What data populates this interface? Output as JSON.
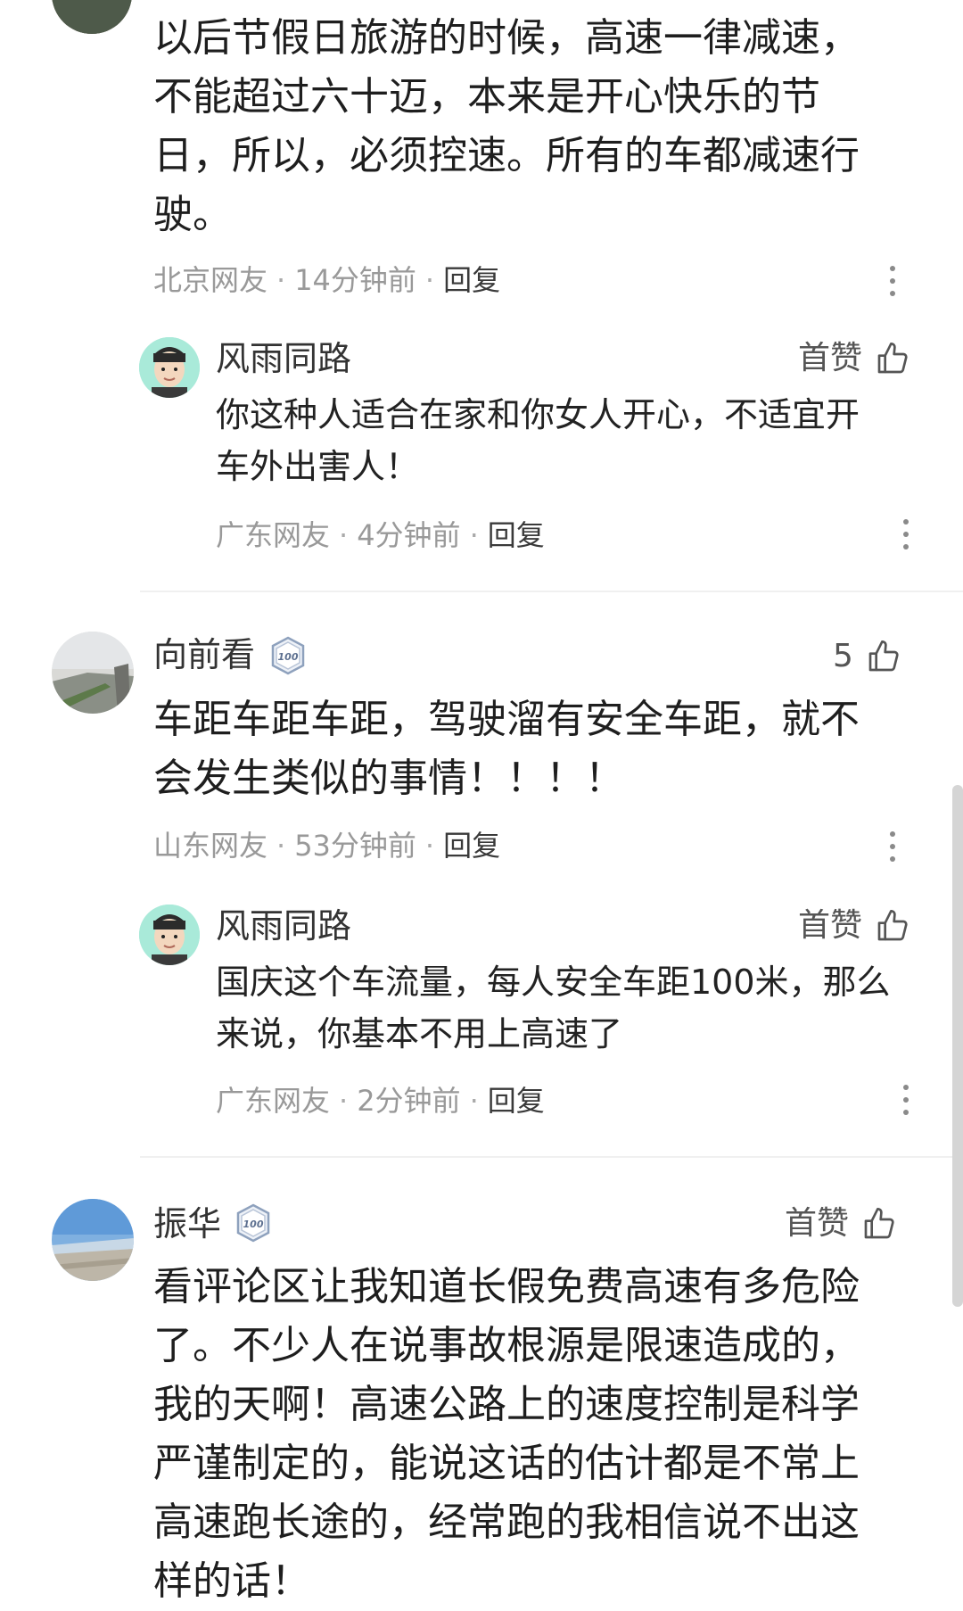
{
  "comments": [
    {
      "text": "以后节假日旅游的时候，高速一律减速，\n不能超过六十迈，本来是开心快乐的节\n日，所以，必须控速。所有的车都减速行\n驶。",
      "location": "北京网友",
      "time": "14分钟前",
      "reply_label": "回复",
      "replies": [
        {
          "username": "风雨同路",
          "likes_label": "首赞",
          "text": "你这种人适合在家和你女人开心，不适宜开\n车外出害人！",
          "location": "广东网友",
          "time": "4分钟前",
          "reply_label": "回复"
        }
      ]
    },
    {
      "username": "向前看",
      "badge": "100",
      "likes_label": "5",
      "text": "车距车距车距，驾驶溜有安全车距，就不\n会发生类似的事情！！！！",
      "location": "山东网友",
      "time": "53分钟前",
      "reply_label": "回复",
      "replies": [
        {
          "username": "风雨同路",
          "likes_label": "首赞",
          "text": "国庆这个车流量，每人安全车距100米，那么\n来说，你基本不用上高速了",
          "location": "广东网友",
          "time": "2分钟前",
          "reply_label": "回复"
        }
      ]
    },
    {
      "username": "振华",
      "badge": "100",
      "likes_label": "首赞",
      "text": "看评论区让我知道长假免费高速有多危险\n了。不少人在说事故根源是限速造成的，\n我的天啊！高速公路上的速度控制是科学\n严谨制定的，能说这话的估计都是不常上\n高速跑长途的，经常跑的我相信说不出这\n样的话！"
    }
  ]
}
